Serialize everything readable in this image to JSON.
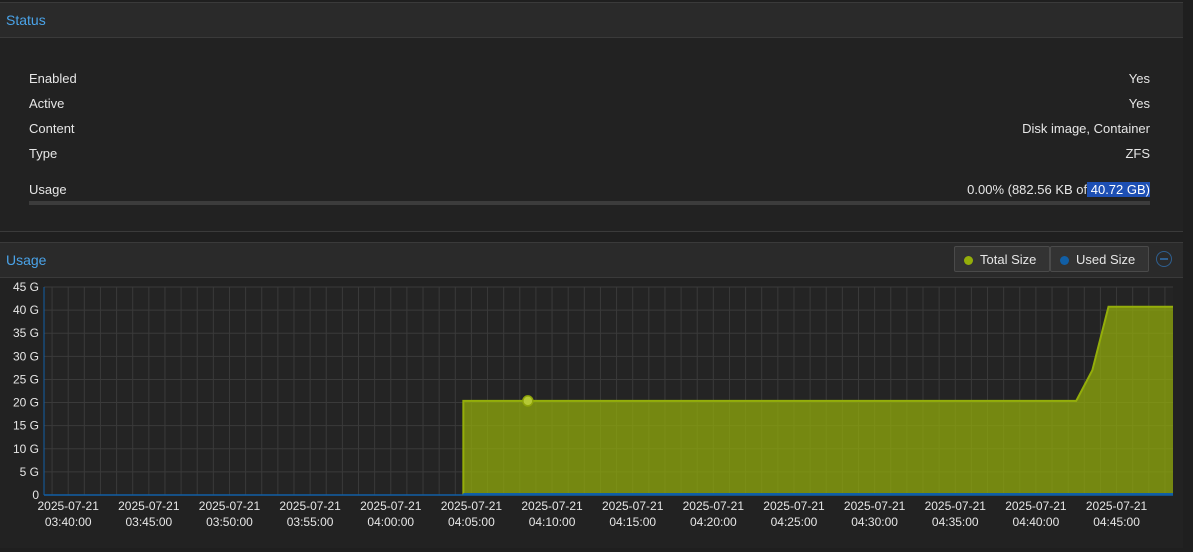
{
  "status": {
    "title": "Status",
    "rows": [
      {
        "key": "Enabled",
        "value": "Yes"
      },
      {
        "key": "Active",
        "value": "Yes"
      },
      {
        "key": "Content",
        "value": "Disk image, Container"
      },
      {
        "key": "Type",
        "value": "ZFS"
      }
    ],
    "usage": {
      "label": "Usage",
      "value_prefix": "0.00% (882.56 KB of",
      "value_highlight": " 40.72 GB)",
      "fraction": 0.0
    }
  },
  "usage_panel": {
    "title": "Usage",
    "legend_total": "Total Size",
    "legend_used": "Used Size",
    "colors": {
      "total": "#94ae0a",
      "used": "#115fa6"
    }
  },
  "chart_data": {
    "type": "area",
    "ylim": [
      0,
      45
    ],
    "yticks": [
      "0",
      "5 G",
      "10 G",
      "15 G",
      "20 G",
      "25 G",
      "30 G",
      "35 G",
      "40 G",
      "45 G"
    ],
    "ytick_values": [
      0,
      5,
      10,
      15,
      20,
      25,
      30,
      35,
      40,
      45
    ],
    "xtick_labels": [
      [
        "2025-07-21",
        "03:40:00"
      ],
      [
        "2025-07-21",
        "03:45:00"
      ],
      [
        "2025-07-21",
        "03:50:00"
      ],
      [
        "2025-07-21",
        "03:55:00"
      ],
      [
        "2025-07-21",
        "04:00:00"
      ],
      [
        "2025-07-21",
        "04:05:00"
      ],
      [
        "2025-07-21",
        "04:10:00"
      ],
      [
        "2025-07-21",
        "04:15:00"
      ],
      [
        "2025-07-21",
        "04:20:00"
      ],
      [
        "2025-07-21",
        "04:25:00"
      ],
      [
        "2025-07-21",
        "04:30:00"
      ],
      [
        "2025-07-21",
        "04:35:00"
      ],
      [
        "2025-07-21",
        "04:40:00"
      ],
      [
        "2025-07-21",
        "04:45:00"
      ]
    ],
    "x_range": [
      "2025-07-21 03:38:30",
      "2025-07-21 04:48:30"
    ],
    "series": [
      {
        "name": "Total Size",
        "points": [
          [
            "2025-07-21 04:04:30",
            20.36
          ],
          [
            "2025-07-21 04:42:30",
            20.36
          ],
          [
            "2025-07-21 04:43:30",
            27.0
          ],
          [
            "2025-07-21 04:44:30",
            40.72
          ],
          [
            "2025-07-21 04:48:30",
            40.72
          ]
        ],
        "marker_at": [
          "2025-07-21 04:08:30",
          20.36
        ]
      },
      {
        "name": "Used Size",
        "points": [
          [
            "2025-07-21 04:04:30",
            0.0009
          ],
          [
            "2025-07-21 04:48:30",
            0.0009
          ]
        ]
      }
    ],
    "grid": true
  }
}
